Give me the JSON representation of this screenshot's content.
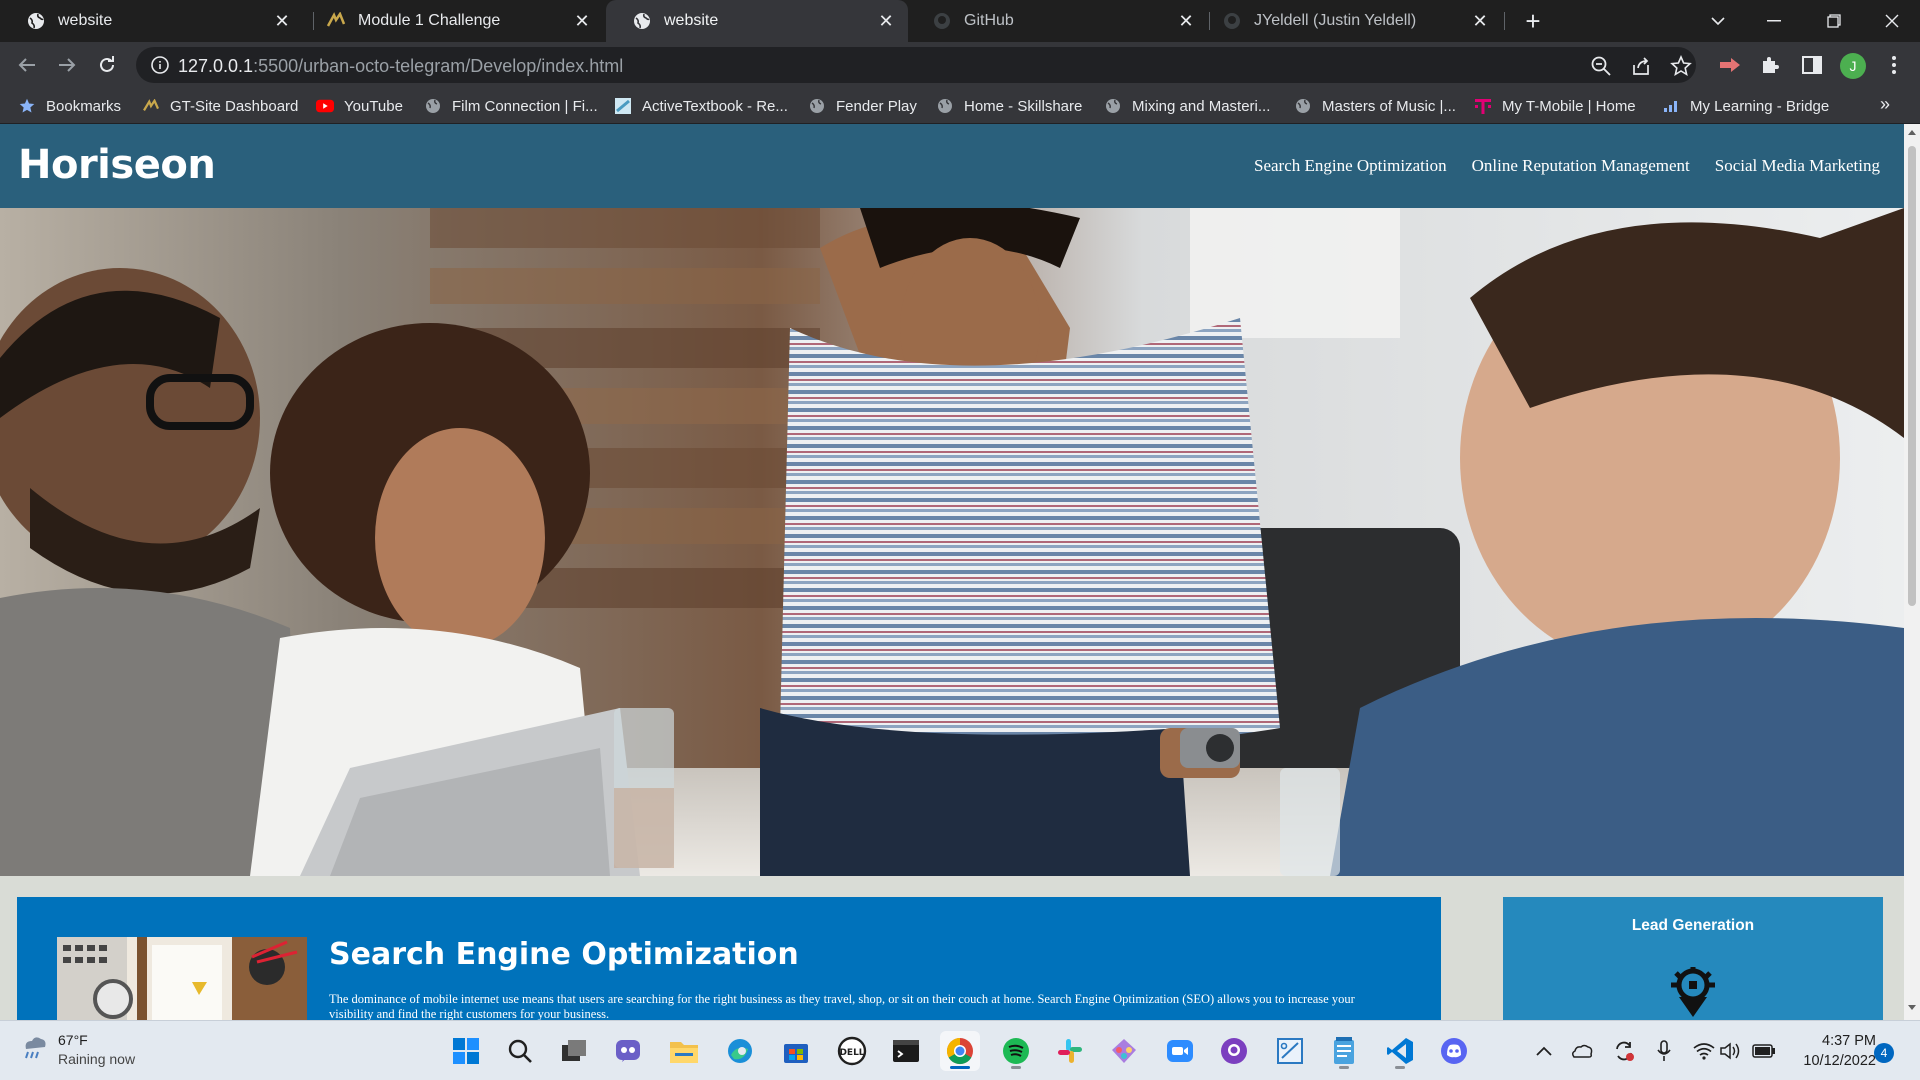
{
  "browser": {
    "tabs": [
      {
        "title": "website",
        "icon": "globe-icon",
        "active": false
      },
      {
        "title": "Module 1 Challenge",
        "icon": "gt-logo-icon",
        "active": false
      },
      {
        "title": "website",
        "icon": "globe-icon",
        "active": true
      },
      {
        "title": "GitHub",
        "icon": "github-icon",
        "active": false
      },
      {
        "title": "JYeldell (Justin Yeldell)",
        "icon": "github-icon",
        "active": false
      }
    ],
    "tab_close_glyph": "✕",
    "new_tab_glyph": "+",
    "url_host": "127.0.0.1",
    "url_path": ":5500/urban-octo-telegram/Develop/index.html",
    "profile_initial": "J",
    "bookmarks": [
      {
        "label": "Bookmarks",
        "icon": "star-icon"
      },
      {
        "label": "GT-Site Dashboard",
        "icon": "gt-logo-icon"
      },
      {
        "label": "YouTube",
        "icon": "youtube-icon"
      },
      {
        "label": "Film Connection | Fi...",
        "icon": "globe-icon"
      },
      {
        "label": "ActiveTextbook - Re...",
        "icon": "book-icon"
      },
      {
        "label": "Fender Play",
        "icon": "globe-icon"
      },
      {
        "label": "Home - Skillshare",
        "icon": "globe-icon"
      },
      {
        "label": "Mixing and Masteri...",
        "icon": "globe-icon"
      },
      {
        "label": "Masters of Music |...",
        "icon": "globe-icon"
      },
      {
        "label": "My T-Mobile | Home",
        "icon": "tmobile-icon"
      },
      {
        "label": "My Learning - Bridge",
        "icon": "bridge-icon"
      }
    ],
    "bookmarks_more": "»"
  },
  "page": {
    "logo": "Horiseon",
    "nav": [
      "Search Engine Optimization",
      "Online Reputation Management",
      "Social Media Marketing"
    ],
    "seo": {
      "title": "Search Engine Optimization",
      "body": "The dominance of mobile internet use means that users are searching for the right business as they travel, shop, or sit on their couch at home. Search Engine Optimization (SEO) allows you to increase your visibility and find the right customers for your business."
    },
    "lead": {
      "title": "Lead Generation",
      "icon": "lead-generation-icon"
    }
  },
  "taskbar": {
    "weather_temp": "67°F",
    "weather_desc": "Raining now",
    "apps": [
      "start-icon",
      "search-icon",
      "task-view-icon",
      "teams-icon",
      "file-explorer-icon",
      "edge-icon",
      "store-icon",
      "dell-icon",
      "terminal-icon",
      "chrome-icon",
      "spotify-icon",
      "slack-icon",
      "gitkraken-icon",
      "zoom-icon",
      "github-desktop-icon",
      "snipping-icon",
      "notepad-icon",
      "vscode-icon",
      "discord-icon"
    ],
    "time": "4:37 PM",
    "date": "10/12/2022",
    "notifications": "4"
  },
  "colors": {
    "header": "#2a607c",
    "seo_card": "#0072bb",
    "lead_card": "#2589bd",
    "page_bg": "#d9dcd6"
  }
}
